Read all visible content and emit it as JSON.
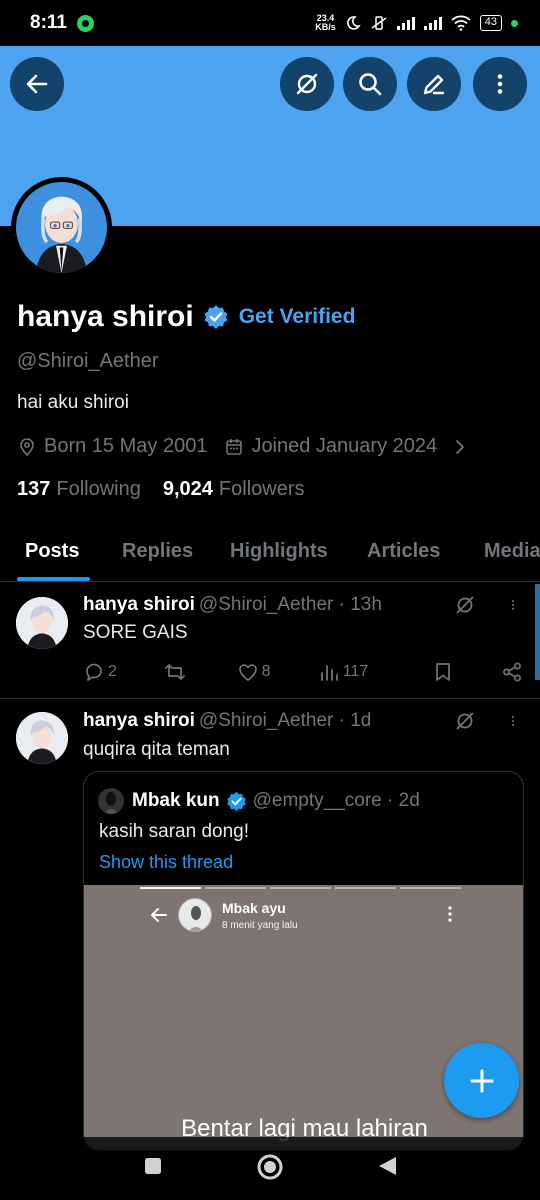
{
  "status_bar": {
    "time": "8:11",
    "net_speed_top": "23.4",
    "net_speed_bottom": "KB/s",
    "battery": "43"
  },
  "profile": {
    "name": "hanya shiroi",
    "get_verified": "Get Verified",
    "handle": "@Shiroi_Aether",
    "bio": "hai aku shiroi",
    "born": "Born 15 May 2001",
    "joined": "Joined January 2024",
    "following_count": "137",
    "following_label": "Following",
    "followers_count": "9,024",
    "followers_label": "Followers"
  },
  "tabs": [
    {
      "label": "Posts",
      "active": true
    },
    {
      "label": "Replies"
    },
    {
      "label": "Highlights"
    },
    {
      "label": "Articles"
    },
    {
      "label": "Media"
    }
  ],
  "tweets": [
    {
      "name": "hanya shiroi",
      "handle_time": "@Shiroi_Aether · 13h",
      "text": "SORE GAIS",
      "replies": "2",
      "retweets": "",
      "likes": "8",
      "views": "117"
    },
    {
      "name": "hanya shiroi",
      "handle_time": "@Shiroi_Aether · 1d",
      "text": "quqira qita teman",
      "quote": {
        "name": "Mbak kun",
        "handle_time": "@empty__core · 2d",
        "text": "kasih saran dong!",
        "show_thread": "Show this thread",
        "media": {
          "name": "Mbak ayu",
          "subtitle": "8 menit yang lalu",
          "caption": "Bentar lagi mau lahiran"
        }
      }
    }
  ],
  "colors": {
    "banner": "#4da3f0",
    "accent": "#1d9bf0",
    "background": "#000000"
  },
  "icons": [
    "back-arrow-icon",
    "grok-icon",
    "search-icon",
    "edit-icon",
    "more-vertical-icon",
    "location-icon",
    "calendar-icon",
    "chevron-right-icon",
    "reply-icon",
    "retweet-icon",
    "like-icon",
    "views-icon",
    "bookmark-icon",
    "share-icon",
    "plus-icon"
  ]
}
